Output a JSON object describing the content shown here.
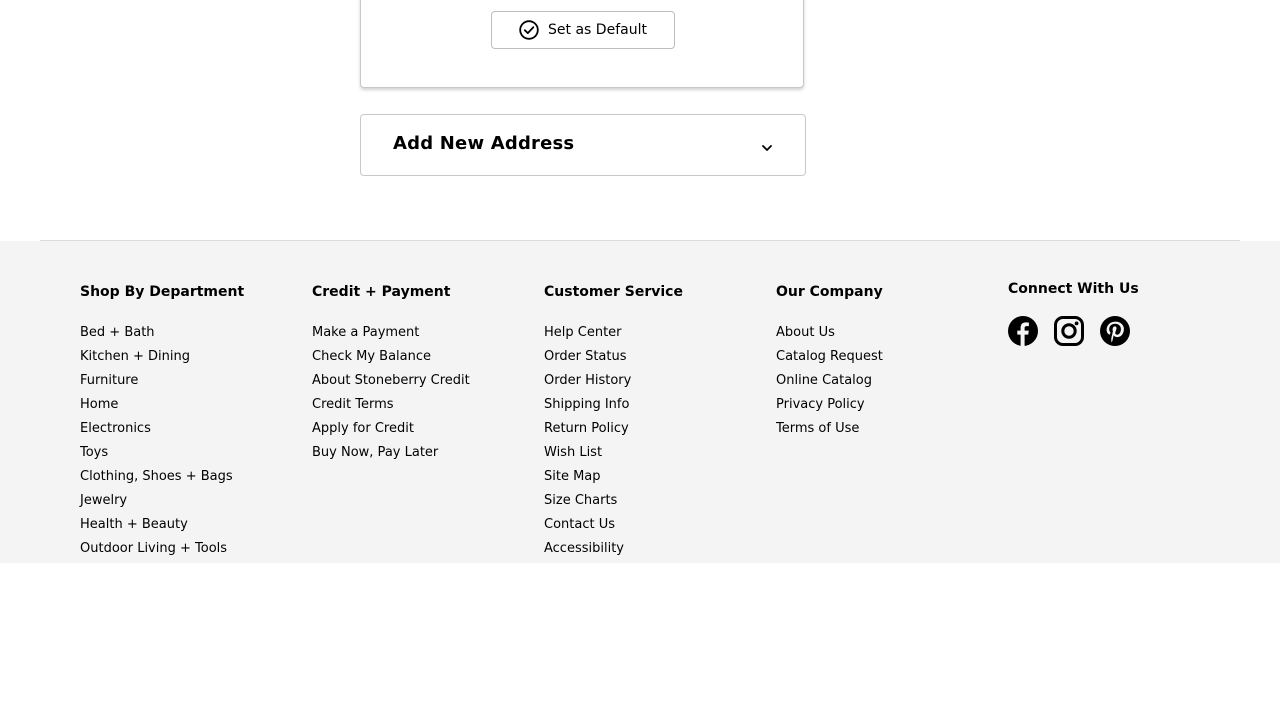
{
  "address_card": {
    "set_default_label": "Set as Default"
  },
  "add_address": {
    "title": "Add New Address"
  },
  "footer": {
    "columns": [
      {
        "heading": "Shop By Department",
        "links": [
          "Bed + Bath",
          "Kitchen + Dining",
          "Furniture",
          "Home",
          "Electronics",
          "Toys",
          "Clothing, Shoes + Bags",
          "Jewelry",
          "Health + Beauty",
          "Outdoor Living + Tools"
        ]
      },
      {
        "heading": "Credit + Payment",
        "links": [
          "Make a Payment",
          "Check My Balance",
          "About Stoneberry Credit",
          "Credit Terms",
          "Apply for Credit",
          "Buy Now, Pay Later"
        ]
      },
      {
        "heading": "Customer Service",
        "links": [
          "Help Center",
          "Order Status",
          "Order History",
          "Shipping Info",
          "Return Policy",
          "Wish List",
          "Site Map",
          "Size Charts",
          "Contact Us",
          "Accessibility"
        ]
      },
      {
        "heading": "Our Company",
        "links": [
          "About Us",
          "Catalog Request",
          "Online Catalog",
          "Privacy Policy",
          "Terms of Use"
        ]
      }
    ],
    "connect": {
      "heading": "Connect With Us",
      "icons": [
        "facebook-icon",
        "instagram-icon",
        "pinterest-icon"
      ]
    }
  }
}
